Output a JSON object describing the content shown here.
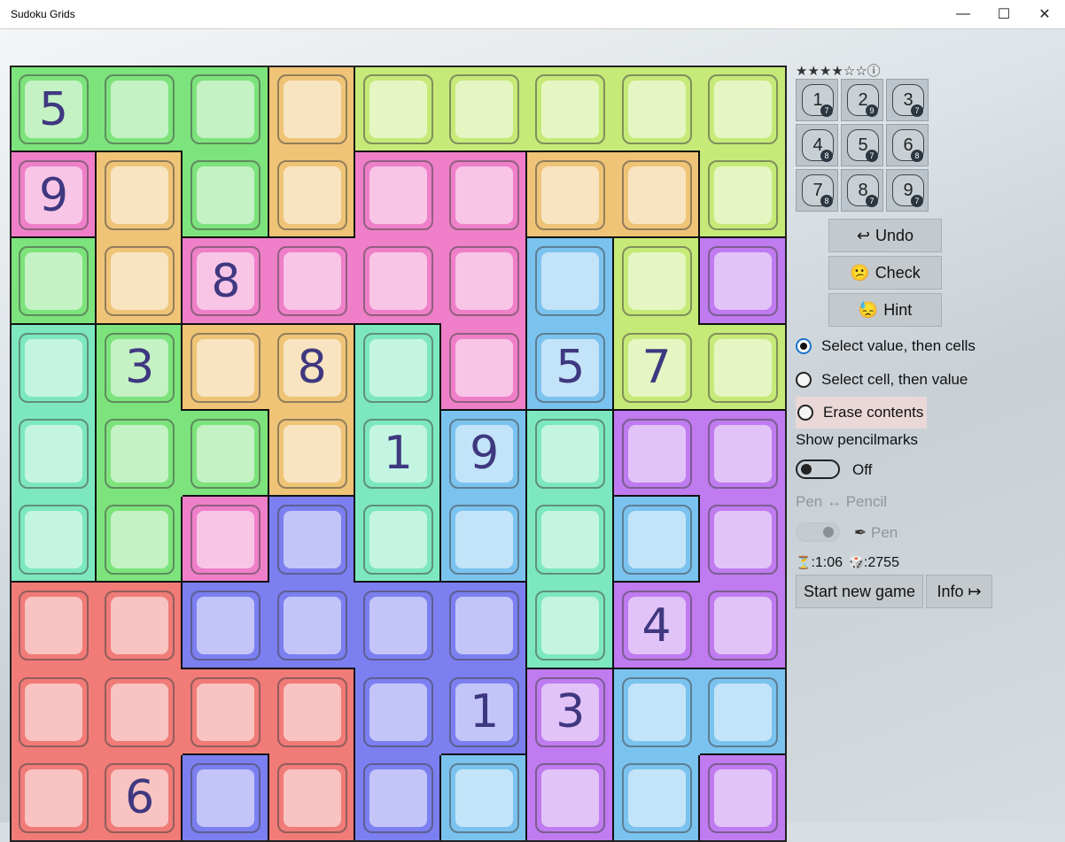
{
  "window": {
    "title": "Sudoku Grids",
    "minimize_glyph": "—",
    "maximize_glyph": "☐",
    "close_glyph": "✕"
  },
  "colors": {
    "green": "#7de37c",
    "orange": "#efc477",
    "lime": "#c6ea78",
    "pink": "#ef7fc9",
    "sky": "#7bc3ef",
    "purple": "#bf7bef",
    "teal": "#7de8c0",
    "blue": "#7b7ff0",
    "red": "#f07b77"
  },
  "board": {
    "regions": [
      [
        "green",
        "green",
        "green",
        "orange",
        "lime",
        "lime",
        "lime",
        "lime",
        "lime"
      ],
      [
        "pink",
        "orange",
        "green",
        "orange",
        "pink",
        "pink",
        "orange",
        "orange",
        "lime"
      ],
      [
        "green",
        "orange",
        "pink",
        "pink",
        "pink",
        "pink",
        "sky",
        "lime",
        "purple"
      ],
      [
        "teal",
        "green",
        "orange",
        "orange",
        "teal",
        "pink",
        "sky",
        "lime",
        "lime"
      ],
      [
        "teal",
        "green",
        "green",
        "orange",
        "teal",
        "sky",
        "teal",
        "purple",
        "purple"
      ],
      [
        "teal",
        "green",
        "pink",
        "blue",
        "teal",
        "sky",
        "teal",
        "sky",
        "purple"
      ],
      [
        "red",
        "red",
        "blue",
        "blue",
        "blue",
        "blue",
        "teal",
        "purple",
        "purple"
      ],
      [
        "red",
        "red",
        "red",
        "red",
        "blue",
        "blue",
        "purple",
        "sky",
        "sky"
      ],
      [
        "red",
        "red",
        "blue",
        "red",
        "blue",
        "sky",
        "purple",
        "sky",
        "purple"
      ]
    ],
    "values": [
      [
        "5",
        "",
        "",
        "",
        "",
        "",
        "",
        "",
        ""
      ],
      [
        "9",
        "",
        "",
        "",
        "",
        "",
        "",
        "",
        ""
      ],
      [
        "",
        "",
        "8",
        "",
        "",
        "",
        "",
        "",
        ""
      ],
      [
        "",
        "3",
        "",
        "8",
        "",
        "",
        "5",
        "7",
        ""
      ],
      [
        "",
        "",
        "",
        "",
        "1",
        "9",
        "",
        "",
        ""
      ],
      [
        "",
        "",
        "",
        "",
        "",
        "",
        "",
        "",
        ""
      ],
      [
        "",
        "",
        "",
        "",
        "",
        "",
        "",
        "4",
        ""
      ],
      [
        "",
        "",
        "",
        "",
        "",
        "1",
        "3",
        "",
        ""
      ],
      [
        "",
        "6",
        "",
        "",
        "",
        "",
        "",
        "",
        ""
      ]
    ]
  },
  "panel": {
    "difficulty": "★★★★☆☆ⓘ",
    "numpad": [
      {
        "digit": "1",
        "count": "7"
      },
      {
        "digit": "2",
        "count": "9"
      },
      {
        "digit": "3",
        "count": "7"
      },
      {
        "digit": "4",
        "count": "8"
      },
      {
        "digit": "5",
        "count": "7"
      },
      {
        "digit": "6",
        "count": "8"
      },
      {
        "digit": "7",
        "count": "8"
      },
      {
        "digit": "8",
        "count": "7"
      },
      {
        "digit": "9",
        "count": "7"
      }
    ],
    "undo": {
      "icon": "↩",
      "label": "Undo"
    },
    "check": {
      "icon": "😕",
      "label": "Check"
    },
    "hint": {
      "icon": "😓",
      "label": "Hint"
    },
    "mode_options": [
      {
        "label": "Select value, then cells",
        "selected": true
      },
      {
        "label": "Select cell, then value",
        "selected": false
      },
      {
        "label": "Erase contents",
        "selected": false
      }
    ],
    "pencilmarks_label": "Show pencilmarks",
    "pencilmarks_state": "Off",
    "pen_pencil_label": "Pen ↔ Pencil",
    "pen_icon": "✒",
    "pen_state": "Pen",
    "timer_icon": "⏳",
    "timer": ":1:06",
    "score_icon": "🎲",
    "score": ":2755",
    "new_game": "Start new game",
    "info": "Info ↦"
  }
}
